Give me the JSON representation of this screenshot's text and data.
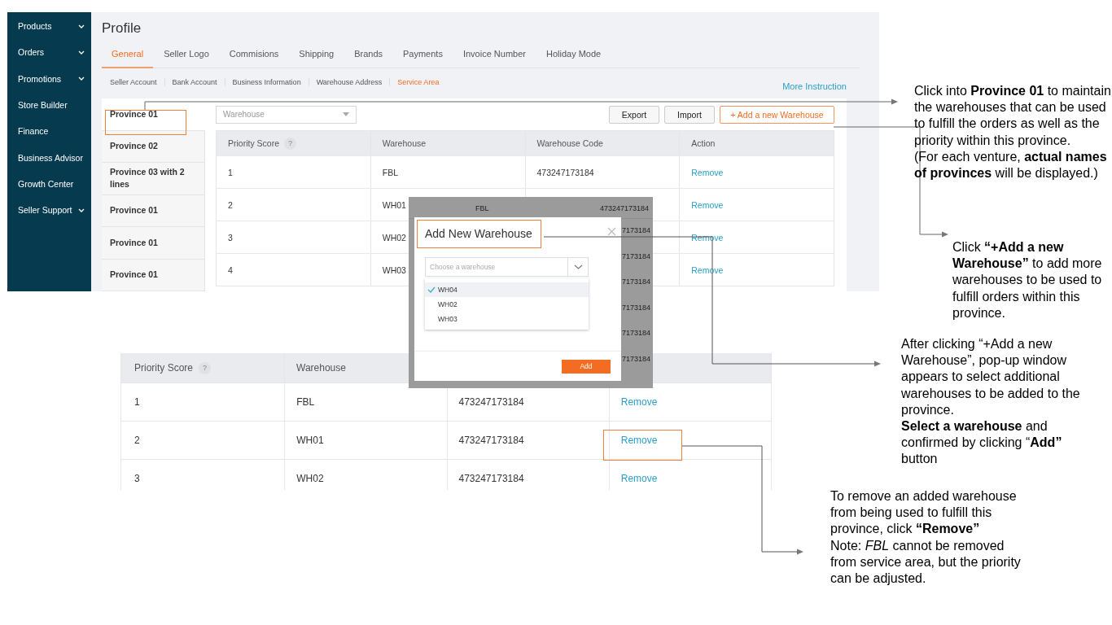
{
  "sidebar": {
    "items": [
      {
        "label": "Products",
        "expandable": true
      },
      {
        "label": "Orders",
        "expandable": true
      },
      {
        "label": "Promotions",
        "expandable": true
      },
      {
        "label": "Store Builder",
        "expandable": false
      },
      {
        "label": "Finance",
        "expandable": false
      },
      {
        "label": "Business Advisor",
        "expandable": false
      },
      {
        "label": "Growth Center",
        "expandable": false
      },
      {
        "label": "Seller Support",
        "expandable": true
      }
    ]
  },
  "page_title": "Profile",
  "tabs": [
    {
      "label": "General",
      "selected": true
    },
    {
      "label": "Seller Logo",
      "selected": false
    },
    {
      "label": "Commisions",
      "selected": false
    },
    {
      "label": "Shipping",
      "selected": false
    },
    {
      "label": "Brands",
      "selected": false
    },
    {
      "label": "Payments",
      "selected": false
    },
    {
      "label": "Invoice Number",
      "selected": false
    },
    {
      "label": "Holiday Mode",
      "selected": false
    }
  ],
  "subtabs": [
    {
      "label": "Seller Account",
      "selected": false
    },
    {
      "label": "Bank Account",
      "selected": false
    },
    {
      "label": "Business Information",
      "selected": false
    },
    {
      "label": "Warehouse Address",
      "selected": false
    },
    {
      "label": "Service Area",
      "selected": true
    }
  ],
  "more_instruction": "More Instruction",
  "provinces": [
    {
      "label": "Province 01",
      "selected": true
    },
    {
      "label": "Province 02",
      "selected": false
    },
    {
      "label": "Province 03 with 2 lines",
      "selected": false
    },
    {
      "label": "Province 01",
      "selected": false
    },
    {
      "label": "Province 01",
      "selected": false
    },
    {
      "label": "Province 01",
      "selected": false
    }
  ],
  "warehouse_filter": {
    "placeholder": "Warehouse"
  },
  "buttons": [
    {
      "label": "Export",
      "kind": "plain"
    },
    {
      "label": "Import",
      "kind": "plain"
    },
    {
      "label": "+ Add a new Warehouse",
      "kind": "primary"
    }
  ],
  "table": {
    "columns": [
      {
        "label": "Priority Score",
        "help": "?"
      },
      {
        "label": "Warehouse"
      },
      {
        "label": "Warehouse Code"
      },
      {
        "label": "Action"
      }
    ],
    "rows": [
      {
        "priority": "1",
        "warehouse": "FBL",
        "code": "473247173184",
        "action": "Remove"
      },
      {
        "priority": "2",
        "warehouse": "WH01",
        "action": "Remove"
      },
      {
        "priority": "3",
        "warehouse": "WH02",
        "action": "Remove"
      },
      {
        "priority": "4",
        "warehouse": "WH03",
        "action": "Remove"
      }
    ]
  },
  "dialog": {
    "backdrop_row": {
      "warehouse": "FBL",
      "code": "473247173184"
    },
    "backdrop_fragments": [
      "7173184",
      "7173184",
      "7173184",
      "7173184",
      "7173184",
      "7173184"
    ],
    "title": "Add New Warehouse",
    "select": {
      "placeholder": "Choose a warehouse"
    },
    "options": [
      {
        "label": "WH04",
        "selected": true
      },
      {
        "label": "WH02",
        "selected": false
      },
      {
        "label": "WH03",
        "selected": false
      }
    ],
    "button": "Add"
  },
  "zoomed_table": {
    "columns": [
      {
        "label": "Priority Score",
        "help": "?"
      },
      {
        "label": "Warehouse"
      }
    ],
    "rows": [
      {
        "priority": "1",
        "warehouse": "FBL",
        "code": "473247173184",
        "action": "Remove"
      },
      {
        "priority": "2",
        "warehouse": "WH01",
        "code": "473247173184",
        "action": "Remove"
      },
      {
        "priority": "3",
        "warehouse": "WH02",
        "code": "473247173184",
        "action": "Remove"
      }
    ]
  },
  "callouts": [
    {
      "paragraphs": [
        "Click into **Province 01** to maintain the warehouses that can be used to fulfill the orders as well as the priority within this province.",
        "(For each venture, **actual names of provinces** will be displayed.)"
      ]
    },
    {
      "paragraphs": [
        "Click **“+Add a new Warehouse”** to add more warehouses to be used to fulfill orders within this province."
      ]
    },
    {
      "paragraphs": [
        "After clicking “+Add a new Warehouse”, pop-up window appears to select additional warehouses to be added to the province.",
        "**Select a warehouse** and confirmed by clicking “**Add”** button"
      ]
    },
    {
      "paragraphs": [
        "To remove an added warehouse from being used to fulfill this province, click **“Remove”**",
        "Note: *FBL* cannot be removed from service area, but the priority can be adjusted."
      ]
    }
  ]
}
